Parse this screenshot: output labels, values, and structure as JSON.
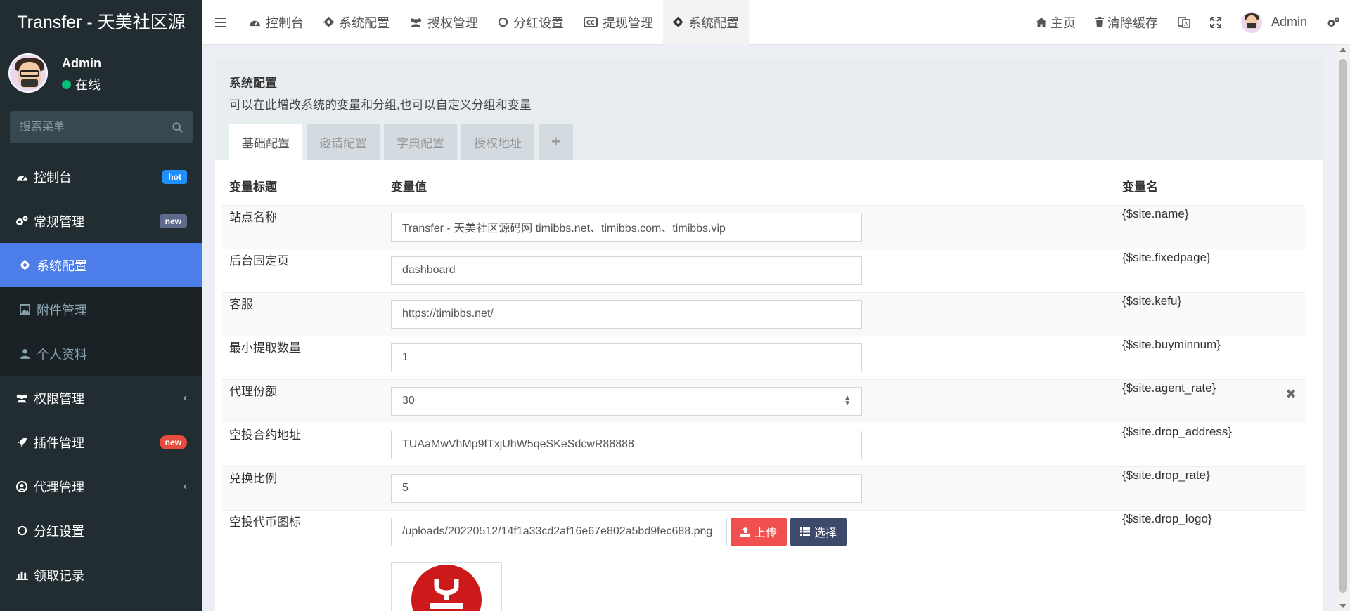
{
  "brand": "Transfer - 天美社区源",
  "user": {
    "name": "Admin",
    "status": "在线"
  },
  "search": {
    "placeholder": "搜索菜单"
  },
  "sidebar": {
    "items": [
      {
        "label": "控制台",
        "badge": "hot",
        "icon": "dashboard-icon"
      },
      {
        "label": "常规管理",
        "badge": "new",
        "icon": "cogs-icon"
      },
      {
        "label": "系统配置",
        "icon": "gear-icon"
      },
      {
        "label": "附件管理",
        "icon": "image-icon"
      },
      {
        "label": "个人资料",
        "icon": "user-icon"
      },
      {
        "label": "权限管理",
        "icon": "group-icon"
      },
      {
        "label": "插件管理",
        "badge": "new",
        "icon": "rocket-icon"
      },
      {
        "label": "代理管理",
        "icon": "user-circle-icon"
      },
      {
        "label": "分红设置",
        "icon": "circle-icon"
      },
      {
        "label": "领取记录",
        "icon": "chart-icon"
      }
    ]
  },
  "navbar": {
    "tabs": [
      "控制台",
      "系统配置",
      "授权管理",
      "分红设置",
      "提现管理",
      "系统配置"
    ],
    "home": "主页",
    "clear_cache": "清除缓存",
    "user": "Admin"
  },
  "panel": {
    "title": "系统配置",
    "desc": "可以在此增改系统的变量和分组,也可以自定义分组和变量",
    "tabs": [
      "基础配置",
      "邀请配置",
      "字典配置",
      "授权地址",
      "+"
    ]
  },
  "table": {
    "headers": [
      "变量标题",
      "变量值",
      "变量名"
    ],
    "rows": [
      {
        "title": "站点名称",
        "value": "Transfer - 天美社区源码网 timibbs.net、timibbs.com、timibbs.vip",
        "name": "{$site.name}"
      },
      {
        "title": "后台固定页",
        "value": "dashboard",
        "name": "{$site.fixedpage}"
      },
      {
        "title": "客服",
        "value": "https://timibbs.net/",
        "name": "{$site.kefu}"
      },
      {
        "title": "最小提取数量",
        "value": "1",
        "name": "{$site.buyminnum}"
      },
      {
        "title": "代理份额",
        "value": "30",
        "name": "{$site.agent_rate}"
      },
      {
        "title": "空投合约地址",
        "value": "TUAaMwVhMp9fTxjUhW5qeSKeSdcwR88888",
        "name": "{$site.drop_address}"
      },
      {
        "title": "兑换比例",
        "value": "5",
        "name": "{$site.drop_rate}"
      },
      {
        "title": "空投代币图标",
        "value": "/uploads/20220512/14f1a33cd2af16e67e802a5bd9fec688.png",
        "name": "{$site.drop_logo}"
      }
    ],
    "upload_label": "上传",
    "choose_label": "选择"
  },
  "colors": {
    "sidebar": "#222d32",
    "accent": "#4c7de8",
    "danger": "#f05050",
    "dark_btn": "#3d4a6b"
  }
}
